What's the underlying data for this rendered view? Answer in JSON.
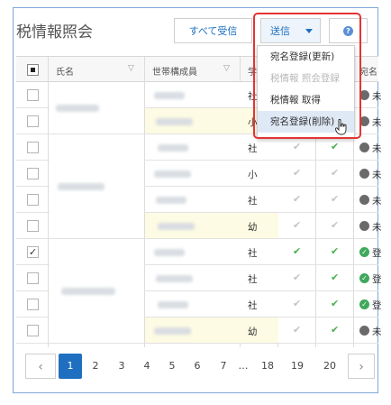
{
  "page": {
    "title": "税情報照会"
  },
  "toolbar": {
    "receive_all_label": "すべて受信",
    "send_label": "送信",
    "help_icon": "help-circle-icon"
  },
  "send_menu": {
    "items": [
      {
        "label": "宛名登録(更新)",
        "state": "normal"
      },
      {
        "label": "税情報 照会登録",
        "state": "disabled"
      },
      {
        "label": "税情報 取得",
        "state": "normal"
      },
      {
        "label": "宛名登録(削除)",
        "state": "hover"
      }
    ]
  },
  "table": {
    "headers": {
      "name": "氏名",
      "household": "世帯構成員",
      "col4": "学",
      "col7": "宛名"
    },
    "rows": [
      {
        "checked": false,
        "highlight": false,
        "kind": "社",
        "c5": true,
        "c6": true,
        "status": "gray",
        "status_text": "未"
      },
      {
        "checked": false,
        "highlight": true,
        "kind": "小",
        "c5": true,
        "c6": true,
        "status": "gray",
        "status_text": "未"
      },
      {
        "checked": false,
        "highlight": false,
        "kind": "社",
        "c5": false,
        "c6": true,
        "status": "gray",
        "status_text": "未"
      },
      {
        "checked": false,
        "highlight": false,
        "kind": "小",
        "c5": false,
        "c6": false,
        "status": "gray",
        "status_text": "未"
      },
      {
        "checked": false,
        "highlight": false,
        "kind": "社",
        "c5": false,
        "c6": false,
        "status": "gray",
        "status_text": "未"
      },
      {
        "checked": false,
        "highlight": true,
        "kind": "幼",
        "c5": false,
        "c6": false,
        "status": "gray",
        "status_text": "未"
      },
      {
        "checked": true,
        "highlight": false,
        "kind": "社",
        "c5": true,
        "c6": true,
        "status": "green",
        "status_text": "登"
      },
      {
        "checked": false,
        "highlight": false,
        "kind": "社",
        "c5": false,
        "c6": true,
        "status": "green",
        "status_text": "登"
      },
      {
        "checked": false,
        "highlight": false,
        "kind": "社",
        "c5": false,
        "c6": true,
        "status": "green",
        "status_text": "登"
      },
      {
        "checked": false,
        "highlight": true,
        "kind": "幼",
        "c5": false,
        "c6": true,
        "status": "gray",
        "status_text": "未"
      }
    ]
  },
  "pagination": {
    "prev_icon": "chevron-left-icon",
    "next_icon": "chevron-right-icon",
    "pages": [
      "1",
      "2",
      "3",
      "4",
      "5",
      "6",
      "7",
      "…",
      "18",
      "19",
      "20"
    ],
    "current": "1"
  },
  "colors": {
    "accent": "#1f6fc1",
    "highlight_row": "#fdfbe3",
    "check_green": "#4caf50",
    "check_gray": "#c4c4c4",
    "status_green": "#3fa85c",
    "status_gray": "#6a6a6a",
    "callout_red": "#e53333"
  }
}
